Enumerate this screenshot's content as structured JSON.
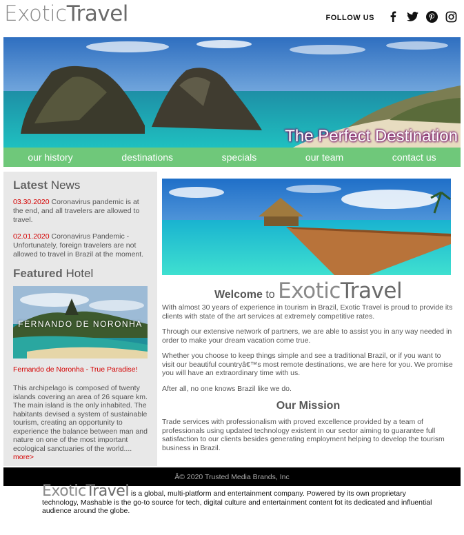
{
  "header": {
    "logo_exotic": "Exotic",
    "logo_travel": "Travel",
    "follow_label": "FOLLOW US",
    "social_icons": [
      "facebook-icon",
      "twitter-icon",
      "pinterest-icon",
      "instagram-icon"
    ]
  },
  "hero": {
    "tagline": "The Perfect Destination"
  },
  "nav": {
    "items": [
      "our history",
      "destinations",
      "specials",
      "our team",
      "contact us"
    ]
  },
  "sidebar": {
    "news_heading_bold": "Latest",
    "news_heading_rest": "News",
    "news": [
      {
        "date": "03.30.2020",
        "text": "Coronavirus pandemic is at the end, and all travelers are allowed to travel."
      },
      {
        "date": "02.01.2020",
        "text": "Coronavirus Pandemic - Unfortunately, foreign travelers are not allowed to travel in Brazil at the moment."
      }
    ],
    "hotel_heading_bold": "Featured",
    "hotel_heading_rest": "Hotel",
    "hotel_image_caption": "FERNANDO DE NORONHA",
    "hotel_title": "Fernando de Noronha - True Paradise!",
    "hotel_desc": "This archipelago is composed of twenty islands covering an area of 26 square km. The main island is the only inhabited. The habitants devised a system of sustainable tourism, creating an opportunity to experience the balance between man and nature on one of the most important ecological sanctuaries of the world....",
    "more_label": "more>"
  },
  "main": {
    "welcome_bold": "Welcome",
    "welcome_to": "to",
    "logo_exotic": "Exotic",
    "logo_travel": "Travel",
    "paragraphs": [
      "With almost 30 years of experience in tourism in Brazil, Exotic Travel is proud to provide its clients with state of the art services at extremely competitive rates.",
      "Through our extensive network of partners, we are able to assist you in any way needed in order to make your dream vacation come true.",
      "Whether you choose to keep things simple and see a traditional Brazil, or if you want to visit our beautiful countryâ€™s most remote destinations, we are here for you. We promise you will have an extraordinary time with us.",
      "After all, no one knows Brazil like we do."
    ],
    "mission_heading": "Our Mission",
    "mission_text": "Trade services with professionalism with proved excellence provided by a team of professionals using updated technology existent in our sector aiming to guarantee full satisfaction to our clients besides generating employment helping to develop the tourism business in Brazil."
  },
  "footer": {
    "copyright": "Â© 2020 Trusted Media Brands, Inc"
  },
  "bottom": {
    "logo_exotic": "Exotic",
    "logo_travel": "Travel",
    "text": " is a global, multi-platform and entertainment company. Powered by its own proprietary technology, Mashable is the go-to source for tech, digital culture and entertainment content fot its dedicated and influential audience around the globe."
  },
  "colors": {
    "nav_green": "#6fc87a",
    "accent_red": "#d40000",
    "sidebar_gray": "#e8e8e8",
    "footer_black": "#000000"
  }
}
